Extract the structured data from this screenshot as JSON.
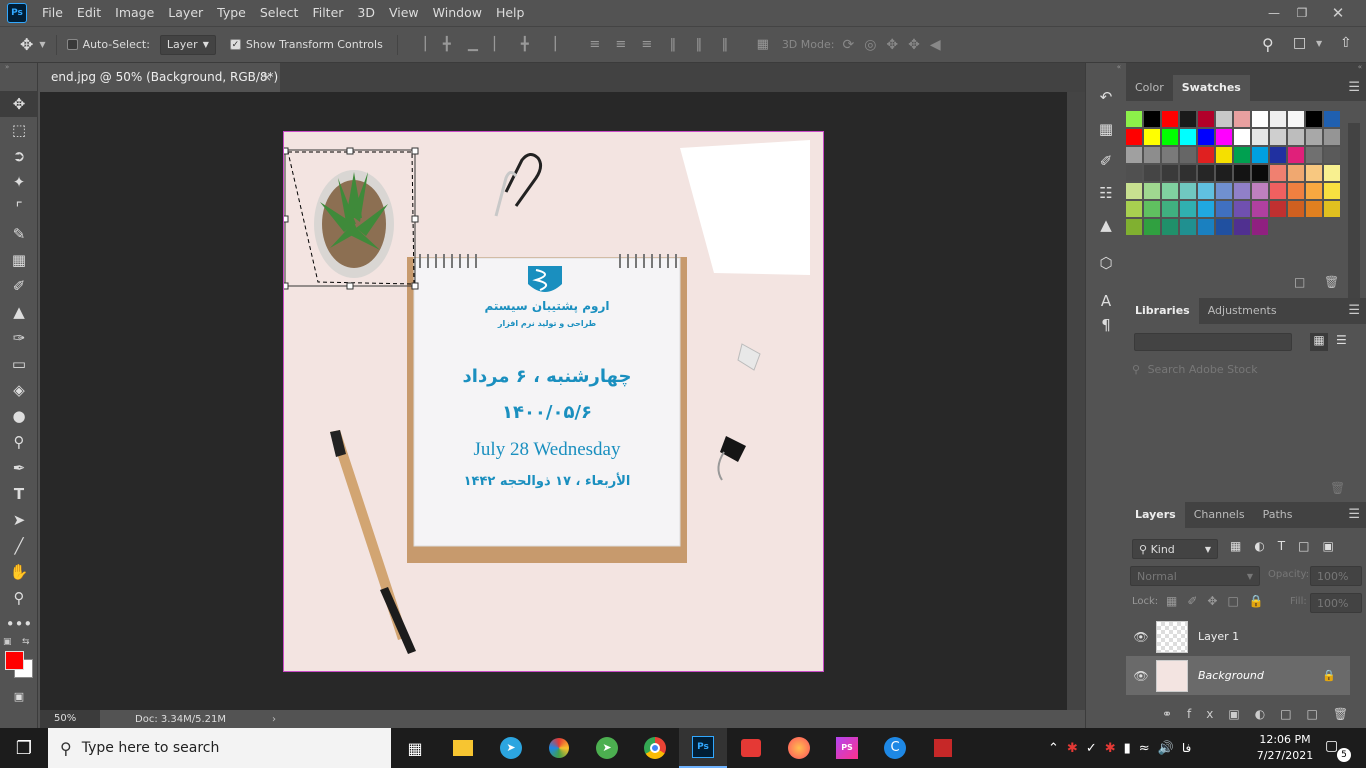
{
  "menu": {
    "items": [
      "File",
      "Edit",
      "Image",
      "Layer",
      "Type",
      "Select",
      "Filter",
      "3D",
      "View",
      "Window",
      "Help"
    ]
  },
  "options": {
    "auto_select_label": "Auto-Select:",
    "layer_select": "Layer",
    "show_transform_label": "Show Transform Controls",
    "mode_label": "3D Mode:"
  },
  "document": {
    "tab_title": "end.jpg @ 50% (Background, RGB/8*) *",
    "close": "×",
    "zoom": "50%",
    "doc_size": "Doc: 3.34M/5.21M"
  },
  "artwork": {
    "company_name": "اروم پشتیبان سیستم",
    "company_tagline": "طراحی و تولید نرم افزار",
    "date_fa": "چهارشنبه ، ۶ مرداد",
    "date_fa_numeric": "۱۴۰۰/۰۵/۶",
    "date_en": "July 28 Wednesday",
    "date_hijri": "الأربعاء ، ۱۷ ذوالحجه ۱۴۴۲"
  },
  "panels": {
    "color_tabs": [
      "Color",
      "Swatches"
    ],
    "library_tabs": [
      "Libraries",
      "Adjustments"
    ],
    "search_placeholder": "Search Adobe Stock",
    "layers_tabs": [
      "Layers",
      "Channels",
      "Paths"
    ],
    "kind_label": "Kind",
    "blend_mode": "Normal",
    "opacity_label": "Opacity:",
    "opacity_value": "100%",
    "lock_label": "Lock:",
    "fill_label": "Fill:",
    "fill_value": "100%",
    "layers": [
      {
        "name": "Layer 1"
      },
      {
        "name": "Background"
      }
    ]
  },
  "swatches": [
    "#8cf04a",
    "#000000",
    "#ff0000",
    "#1a1a1a",
    "#b2002a",
    "#c8c8c8",
    "#e8a0a0",
    "#ffffff",
    "#efefef",
    "#f7f7f7",
    "#000000",
    "#2060b0",
    "#ff0000",
    "#ffff00",
    "#00ff00",
    "#00ffff",
    "#0000ff",
    "#ff00ff",
    "#ffffff",
    "#e6e6e6",
    "#cfcfcf",
    "#bdbdbd",
    "#a8a8a8",
    "#959595",
    "#a0a0a0",
    "#8d8d8d",
    "#7a7a7a",
    "#666666",
    "#e02020",
    "#f5e000",
    "#00a050",
    "#00a0e0",
    "#2030a0",
    "#e0207a",
    "#707070",
    "#5a5a5a",
    "#505050",
    "#454545",
    "#3a3a3a",
    "#303030",
    "#262626",
    "#1e1e1e",
    "#141414",
    "#0a0a0a",
    "#f08070",
    "#f0a870",
    "#f8c880",
    "#f8f090",
    "#c8e090",
    "#a0d890",
    "#80d0a0",
    "#70c8c0",
    "#60c0e0",
    "#7090d0",
    "#9080c8",
    "#c080c0",
    "#f06060",
    "#f08040",
    "#f8a840",
    "#f8e040",
    "#a8d050",
    "#60c060",
    "#40b080",
    "#30b0b0",
    "#20a8e0",
    "#4070c0",
    "#7050b0",
    "#b040a0",
    "#c03030",
    "#d06020",
    "#e08020",
    "#e0c020",
    "#80b030",
    "#30a040",
    "#20906a",
    "#209090",
    "#1a80c0",
    "#2050a0",
    "#503090",
    "#902080"
  ],
  "clock": {
    "time": "12:06 PM",
    "date": "7/27/2021"
  },
  "taskbar": {
    "search_placeholder": "Type here to search",
    "lang": "فا",
    "notification_count": "5"
  }
}
